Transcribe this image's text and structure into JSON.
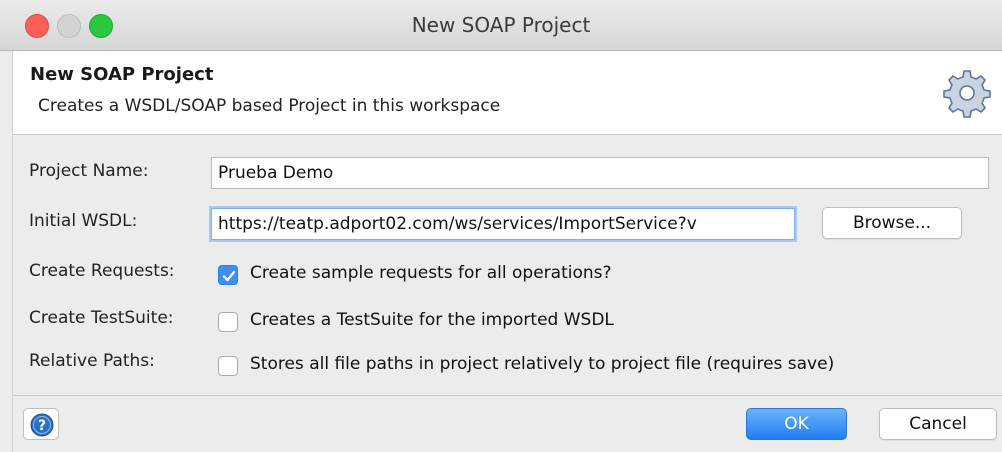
{
  "window": {
    "title": "New SOAP Project"
  },
  "banner": {
    "title": "New SOAP Project",
    "description": "Creates a WSDL/SOAP based Project in this workspace",
    "icon": "gear-icon"
  },
  "form": {
    "project_name": {
      "label": "Project Name:",
      "value": "Prueba Demo"
    },
    "initial_wsdl": {
      "label": "Initial WSDL:",
      "value": "https://teatp.adport02.com/ws/services/ImportService?v",
      "browse_label": "Browse..."
    },
    "create_requests": {
      "label": "Create Requests:",
      "checkbox_label": "Create sample requests for all operations?",
      "checked": true
    },
    "create_testsuite": {
      "label": "Create TestSuite:",
      "checkbox_label": "Creates a TestSuite for the imported WSDL",
      "checked": false
    },
    "relative_paths": {
      "label": "Relative Paths:",
      "checkbox_label": "Stores all file paths in project relatively to project file (requires save)",
      "checked": false
    }
  },
  "footer": {
    "help_icon": "help-icon",
    "ok_label": "OK",
    "cancel_label": "Cancel"
  },
  "colors": {
    "accent": "#3c8ff7",
    "close": "#fc5f57",
    "maximize": "#29c840"
  }
}
